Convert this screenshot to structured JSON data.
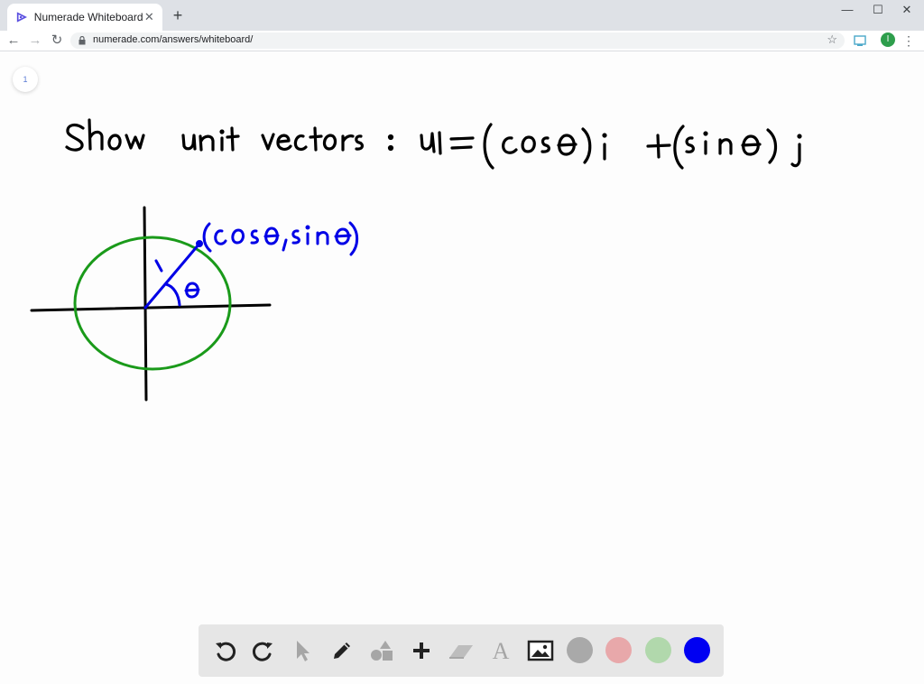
{
  "browser": {
    "tab_title": "Numerade Whiteboard",
    "tab_close": "✕",
    "new_tab": "+",
    "url": "numerade.com/answers/whiteboard/",
    "window_minimize": "—",
    "window_maximize": "☐",
    "window_close": "✕",
    "profile_initial": "I",
    "menu": "⋮",
    "star": "☆"
  },
  "page": {
    "page_number": "1"
  },
  "whiteboard": {
    "line1_words": [
      "Show",
      "unit",
      "vectors",
      ":",
      "u",
      "=",
      "(cos θ)",
      "i",
      "+",
      "(sin θ)",
      "j"
    ],
    "point_label": "(cos θ, sin θ)",
    "radius_label": "1",
    "angle_label": "θ",
    "colors": {
      "ink": "#000000",
      "circle": "#1a9a1a",
      "vector": "#0000e6"
    }
  },
  "toolbar": {
    "tools": [
      "undo-icon",
      "redo-icon",
      "pointer-icon",
      "pen-icon",
      "shapes-icon",
      "add-icon",
      "eraser-icon",
      "text-icon",
      "image-icon"
    ],
    "swatches": [
      {
        "name": "gray",
        "color": "#a9a9a9"
      },
      {
        "name": "pink",
        "color": "#e8a8aa"
      },
      {
        "name": "light-green",
        "color": "#b1d8ac"
      },
      {
        "name": "blue",
        "color": "#0000f2"
      }
    ]
  }
}
